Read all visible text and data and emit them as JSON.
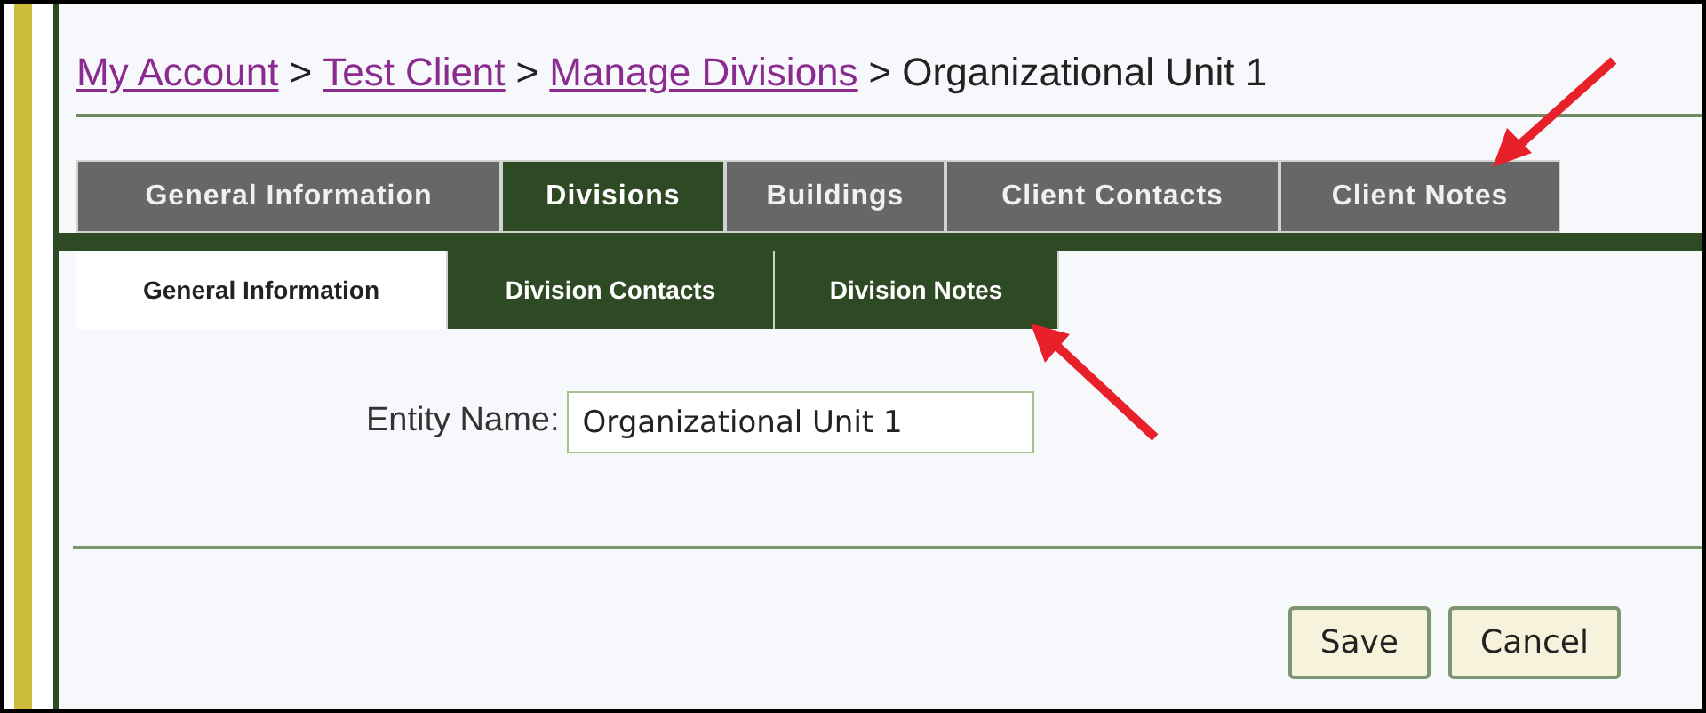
{
  "breadcrumb": [
    {
      "text": "My Account",
      "kind": "link"
    },
    {
      "text": ">",
      "kind": "separator"
    },
    {
      "text": "Test Client",
      "kind": "link"
    },
    {
      "text": ">",
      "kind": "separator"
    },
    {
      "text": "Manage Divisions",
      "kind": "link"
    },
    {
      "text": ">",
      "kind": "separator"
    },
    {
      "text": "Organizational Unit 1",
      "kind": "current"
    }
  ],
  "tabs": [
    {
      "label": "General Information",
      "selected": false
    },
    {
      "label": "Divisions",
      "selected": true
    },
    {
      "label": "Buildings",
      "selected": false
    },
    {
      "label": "Client Contacts",
      "selected": false
    },
    {
      "label": "Client Notes",
      "selected": false
    }
  ],
  "subtabs": [
    {
      "label": "General Information",
      "selected": true
    },
    {
      "label": "Division Contacts",
      "selected": false
    },
    {
      "label": "Division Notes",
      "selected": false
    }
  ],
  "form": {
    "label": "Entity Name:",
    "value": "Organizational Unit 1"
  },
  "buttons": [
    "Save",
    "Cancel"
  ]
}
